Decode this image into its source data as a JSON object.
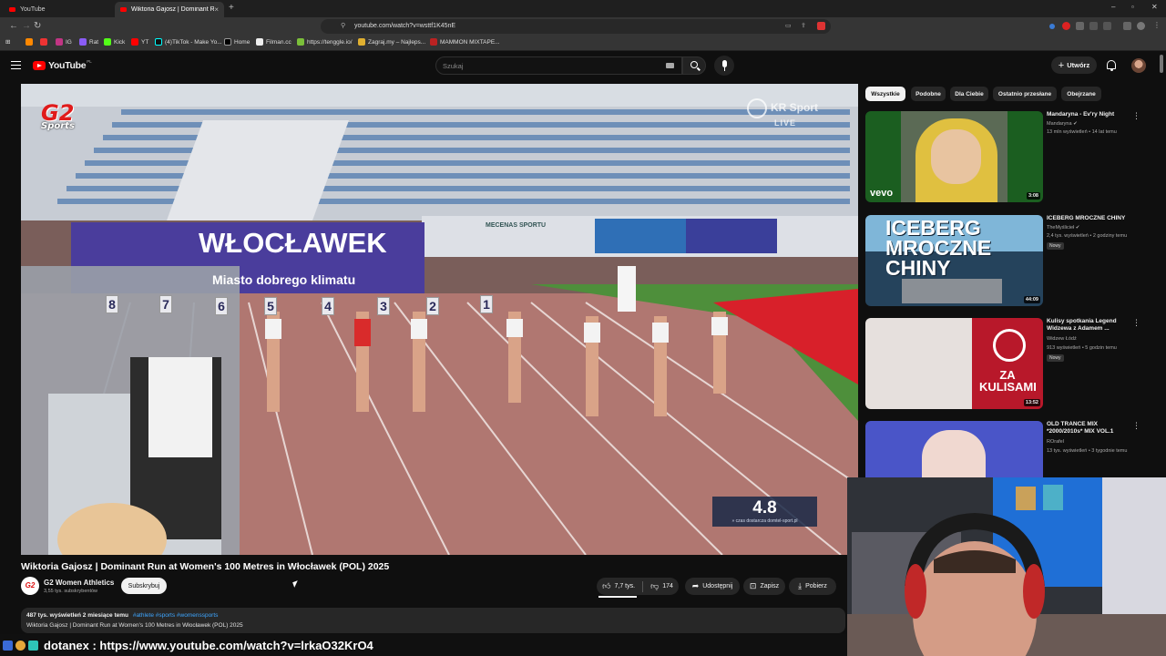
{
  "browser": {
    "tabs": [
      {
        "title": "YouTube",
        "active": false
      },
      {
        "title": "Wiktoria Gajosz | Dominant R",
        "active": true
      }
    ],
    "url": "youtube.com/watch?v=wsttf1K45nE",
    "bookmarks": [
      "IG",
      "Rat",
      "Kick",
      "YT",
      "(4)TikTok - Make Yo...",
      "Home",
      "Filman.cc",
      "https://tenggle.io/",
      "Zagraj.my – Najleps...",
      "MAMMON MIXTAPE..."
    ]
  },
  "youtube": {
    "logo_text": "YouTube",
    "logo_country": "PL",
    "search_placeholder": "Szukaj",
    "create_label": "Utwórz"
  },
  "player": {
    "watermark": "G2",
    "watermark_sub": "Sports",
    "broadcaster": "KR Sport",
    "broadcaster_sub": "LIVE",
    "timer_value": "4.8",
    "timer_caption": "» czas dostarcza domtel-sport.pl",
    "banner_city": "WŁOCŁAWEK",
    "banner_slogan": "Miasto dobrego klimatu",
    "sponsor_label": "MECENAS SPORTU",
    "lane_numbers": [
      "8",
      "7",
      "6",
      "5",
      "4",
      "3",
      "2",
      "1"
    ]
  },
  "video": {
    "title": "Wiktoria Gajosz | Dominant Run at Women's 100 Metres in Włocławek (POL) 2025",
    "channel": "G2 Women Athletics",
    "channel_avatar": "G2",
    "subscribers": "3,55 tys. subskrybentów",
    "subscribe_label": "Subskrybuj",
    "likes": "7,7 tys.",
    "dislikes": "174",
    "share_label": "Udostępnij",
    "save_label": "Zapisz",
    "download_label": "Pobierz",
    "views_date": "487 tys. wyświetleń  2 miesiące temu",
    "hashtags": "#athlete #sports #womenssports",
    "description_line": "Wiktoria Gajosz | Dominant Run at Women's 100 Metres in Włocławek (POL) 2025"
  },
  "chips": [
    "Wszystkie",
    "Podobne",
    "Dla Ciebie",
    "Ostatnio przesłane",
    "Obejrzane"
  ],
  "recommendations": [
    {
      "title": "Mandaryna - Ev'ry Night",
      "channel": "Mandaryna",
      "meta": "13 mln wyświetleń • 14 lat temu",
      "duration": "3:08",
      "badge": "",
      "thumb_text": "vevo"
    },
    {
      "title": "ICEBERG MROCZNE CHINY",
      "channel": "TheMyślicieł",
      "meta": "2,4 tys. wyświetleń • 2 godziny temu",
      "duration": "44:09",
      "badge": "Nowy",
      "thumb_text": "ICEBERG MROCZNE CHINY"
    },
    {
      "title": "Kulisy spotkania Legend Widzewa z Adamem ...",
      "channel": "Widzew Łódź",
      "meta": "913 wyświetleń • 5 godzin temu",
      "duration": "13:52",
      "badge": "Nowy",
      "thumb_text": "ZA KULISAMI"
    },
    {
      "title": "OLD TRANCE MIX *2000/2010s* MIX VOL.1",
      "channel": "ROrafel",
      "meta": "13 tys. wyświetleń • 3 tygodnie temu",
      "duration": "",
      "badge": "",
      "thumb_text": ""
    }
  ],
  "overlay": {
    "chat_text": "dotanex : https://www.youtube.com/watch?v=lrkaO32KrO4"
  }
}
